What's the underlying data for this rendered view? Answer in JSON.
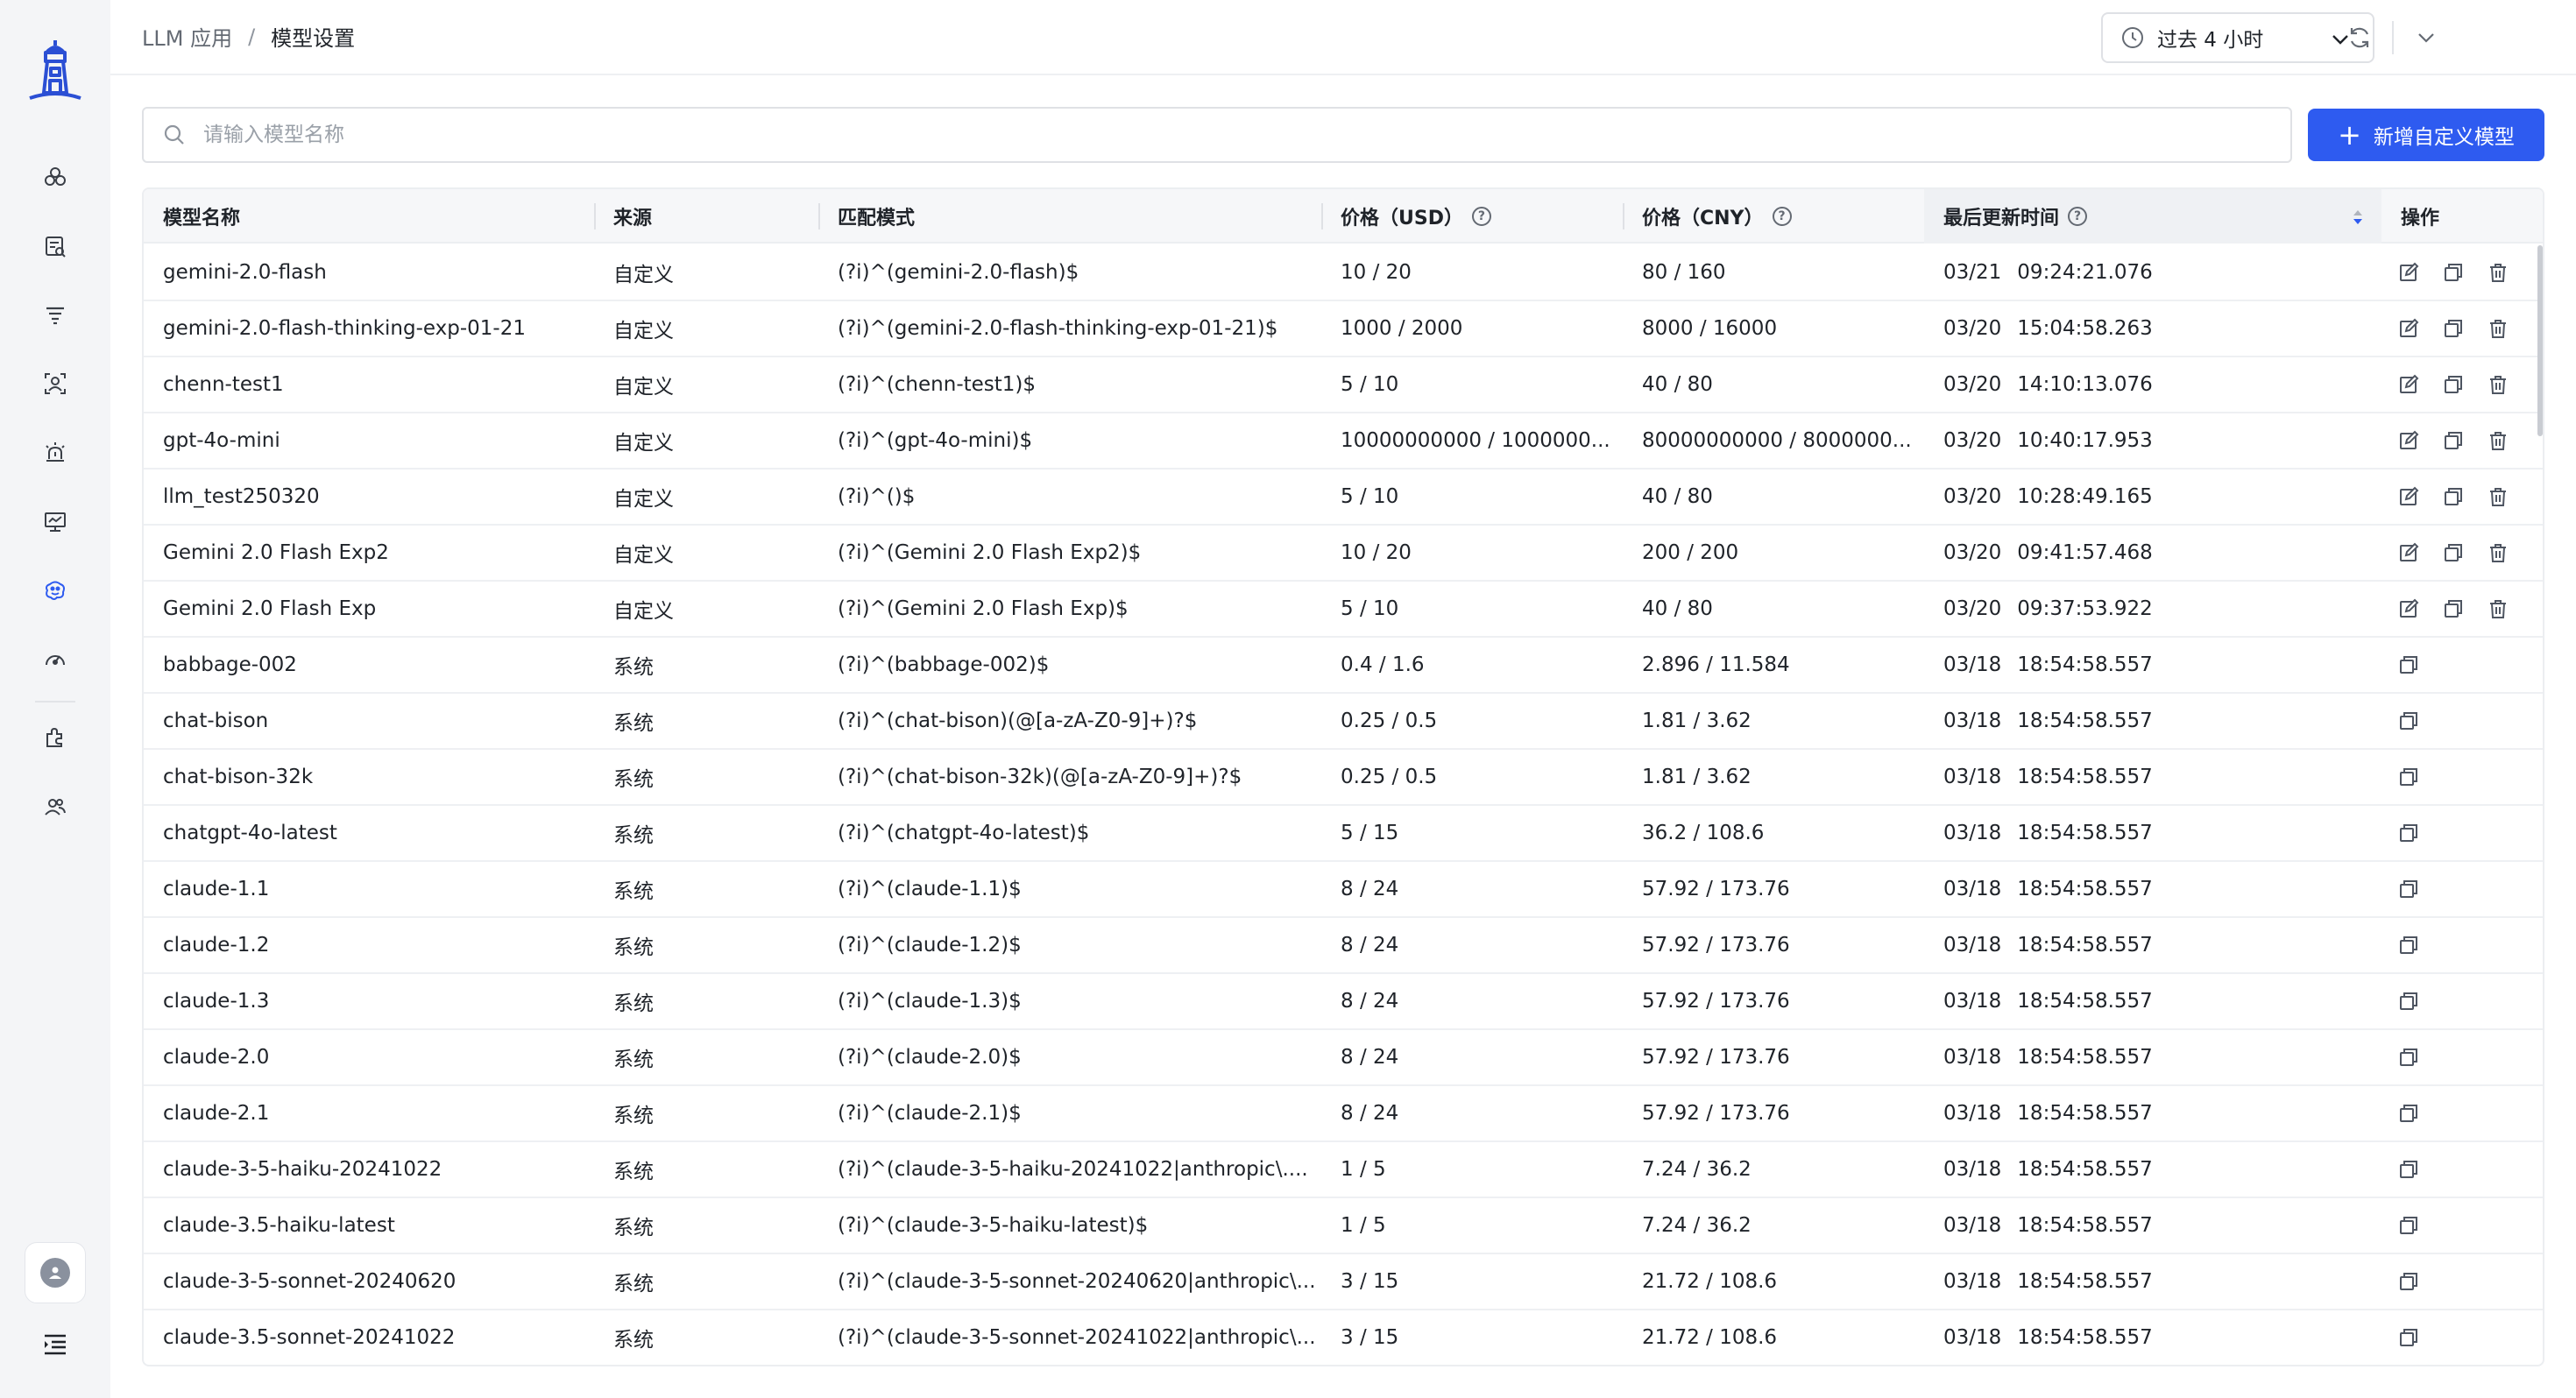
{
  "breadcrumb": {
    "parent": "LLM 应用",
    "separator": "/",
    "current": "模型设置"
  },
  "time_range": {
    "selected": "过去 4 小时"
  },
  "search": {
    "placeholder": "请输入模型名称",
    "value": ""
  },
  "add_button": {
    "label": "新增自定义模型",
    "icon": "plus-icon"
  },
  "colors": {
    "accent": "#2e5bf0",
    "sidebar_bg": "#f4f5f7",
    "logo": "#2b4fd4"
  },
  "sidebar": {
    "icons": [
      "logo-lighthouse-icon",
      "cluster-icon",
      "trace-list-icon",
      "filter-list-icon",
      "user-scan-icon",
      "alarm-icon",
      "monitor-icon",
      "llm-brain-icon",
      "speedometer-icon",
      "plugin-icon",
      "team-icon",
      "user-avatar-icon",
      "collapse-menu-icon"
    ],
    "active": "llm-brain-icon"
  },
  "table": {
    "columns": {
      "name": "模型名称",
      "source": "来源",
      "pattern": "匹配模式",
      "price_usd": "价格（USD）",
      "price_cny": "价格（CNY）",
      "updated": "最后更新时间",
      "actions": "操作"
    },
    "sorted_column": "updated",
    "rows": [
      {
        "name": "gemini-2.0-flash",
        "source": "自定义",
        "pattern": "(?i)^(gemini-2.0-flash)$",
        "usd": "10 / 20",
        "cny": "80 / 160",
        "date": "03/21",
        "time": "09:24:21.076",
        "custom": true
      },
      {
        "name": "gemini-2.0-flash-thinking-exp-01-21",
        "source": "自定义",
        "pattern": "(?i)^(gemini-2.0-flash-thinking-exp-01-21)$",
        "usd": "1000 / 2000",
        "cny": "8000 / 16000",
        "date": "03/20",
        "time": "15:04:58.263",
        "custom": true
      },
      {
        "name": "chenn-test1",
        "source": "自定义",
        "pattern": "(?i)^(chenn-test1)$",
        "usd": "5 / 10",
        "cny": "40 / 80",
        "date": "03/20",
        "time": "14:10:13.076",
        "custom": true
      },
      {
        "name": "gpt-4o-mini",
        "source": "自定义",
        "pattern": "(?i)^(gpt-4o-mini)$",
        "usd": "10000000000 / 1000000...",
        "cny": "80000000000 / 8000000...",
        "date": "03/20",
        "time": "10:40:17.953",
        "custom": true
      },
      {
        "name": "llm_test250320",
        "source": "自定义",
        "pattern": "(?i)^()$",
        "usd": "5 / 10",
        "cny": "40 / 80",
        "date": "03/20",
        "time": "10:28:49.165",
        "custom": true
      },
      {
        "name": "Gemini 2.0 Flash Exp2",
        "source": "自定义",
        "pattern": "(?i)^(Gemini 2.0 Flash Exp2)$",
        "usd": "10 / 20",
        "cny": "200 / 200",
        "date": "03/20",
        "time": "09:41:57.468",
        "custom": true
      },
      {
        "name": "Gemini 2.0 Flash Exp",
        "source": "自定义",
        "pattern": "(?i)^(Gemini 2.0 Flash Exp)$",
        "usd": "5 / 10",
        "cny": "40 / 80",
        "date": "03/20",
        "time": "09:37:53.922",
        "custom": true
      },
      {
        "name": "babbage-002",
        "source": "系统",
        "pattern": "(?i)^(babbage-002)$",
        "usd": "0.4 / 1.6",
        "cny": "2.896 / 11.584",
        "date": "03/18",
        "time": "18:54:58.557",
        "custom": false
      },
      {
        "name": "chat-bison",
        "source": "系统",
        "pattern": "(?i)^(chat-bison)(@[a-zA-Z0-9]+)?$",
        "usd": "0.25 / 0.5",
        "cny": "1.81 / 3.62",
        "date": "03/18",
        "time": "18:54:58.557",
        "custom": false
      },
      {
        "name": "chat-bison-32k",
        "source": "系统",
        "pattern": "(?i)^(chat-bison-32k)(@[a-zA-Z0-9]+)?$",
        "usd": "0.25 / 0.5",
        "cny": "1.81 / 3.62",
        "date": "03/18",
        "time": "18:54:58.557",
        "custom": false
      },
      {
        "name": "chatgpt-4o-latest",
        "source": "系统",
        "pattern": "(?i)^(chatgpt-4o-latest)$",
        "usd": "5 / 15",
        "cny": "36.2 / 108.6",
        "date": "03/18",
        "time": "18:54:58.557",
        "custom": false
      },
      {
        "name": "claude-1.1",
        "source": "系统",
        "pattern": "(?i)^(claude-1.1)$",
        "usd": "8 / 24",
        "cny": "57.92 / 173.76",
        "date": "03/18",
        "time": "18:54:58.557",
        "custom": false
      },
      {
        "name": "claude-1.2",
        "source": "系统",
        "pattern": "(?i)^(claude-1.2)$",
        "usd": "8 / 24",
        "cny": "57.92 / 173.76",
        "date": "03/18",
        "time": "18:54:58.557",
        "custom": false
      },
      {
        "name": "claude-1.3",
        "source": "系统",
        "pattern": "(?i)^(claude-1.3)$",
        "usd": "8 / 24",
        "cny": "57.92 / 173.76",
        "date": "03/18",
        "time": "18:54:58.557",
        "custom": false
      },
      {
        "name": "claude-2.0",
        "source": "系统",
        "pattern": "(?i)^(claude-2.0)$",
        "usd": "8 / 24",
        "cny": "57.92 / 173.76",
        "date": "03/18",
        "time": "18:54:58.557",
        "custom": false
      },
      {
        "name": "claude-2.1",
        "source": "系统",
        "pattern": "(?i)^(claude-2.1)$",
        "usd": "8 / 24",
        "cny": "57.92 / 173.76",
        "date": "03/18",
        "time": "18:54:58.557",
        "custom": false
      },
      {
        "name": "claude-3-5-haiku-20241022",
        "source": "系统",
        "pattern": "(?i)^(claude-3-5-haiku-20241022|anthropic\\....",
        "usd": "1 / 5",
        "cny": "7.24 / 36.2",
        "date": "03/18",
        "time": "18:54:58.557",
        "custom": false
      },
      {
        "name": "claude-3.5-haiku-latest",
        "source": "系统",
        "pattern": "(?i)^(claude-3-5-haiku-latest)$",
        "usd": "1 / 5",
        "cny": "7.24 / 36.2",
        "date": "03/18",
        "time": "18:54:58.557",
        "custom": false
      },
      {
        "name": "claude-3-5-sonnet-20240620",
        "source": "系统",
        "pattern": "(?i)^(claude-3-5-sonnet-20240620|anthropic\\...",
        "usd": "3 / 15",
        "cny": "21.72 / 108.6",
        "date": "03/18",
        "time": "18:54:58.557",
        "custom": false
      },
      {
        "name": "claude-3.5-sonnet-20241022",
        "source": "系统",
        "pattern": "(?i)^(claude-3-5-sonnet-20241022|anthropic\\...",
        "usd": "3 / 15",
        "cny": "21.72 / 108.6",
        "date": "03/18",
        "time": "18:54:58.557",
        "custom": false
      }
    ]
  }
}
